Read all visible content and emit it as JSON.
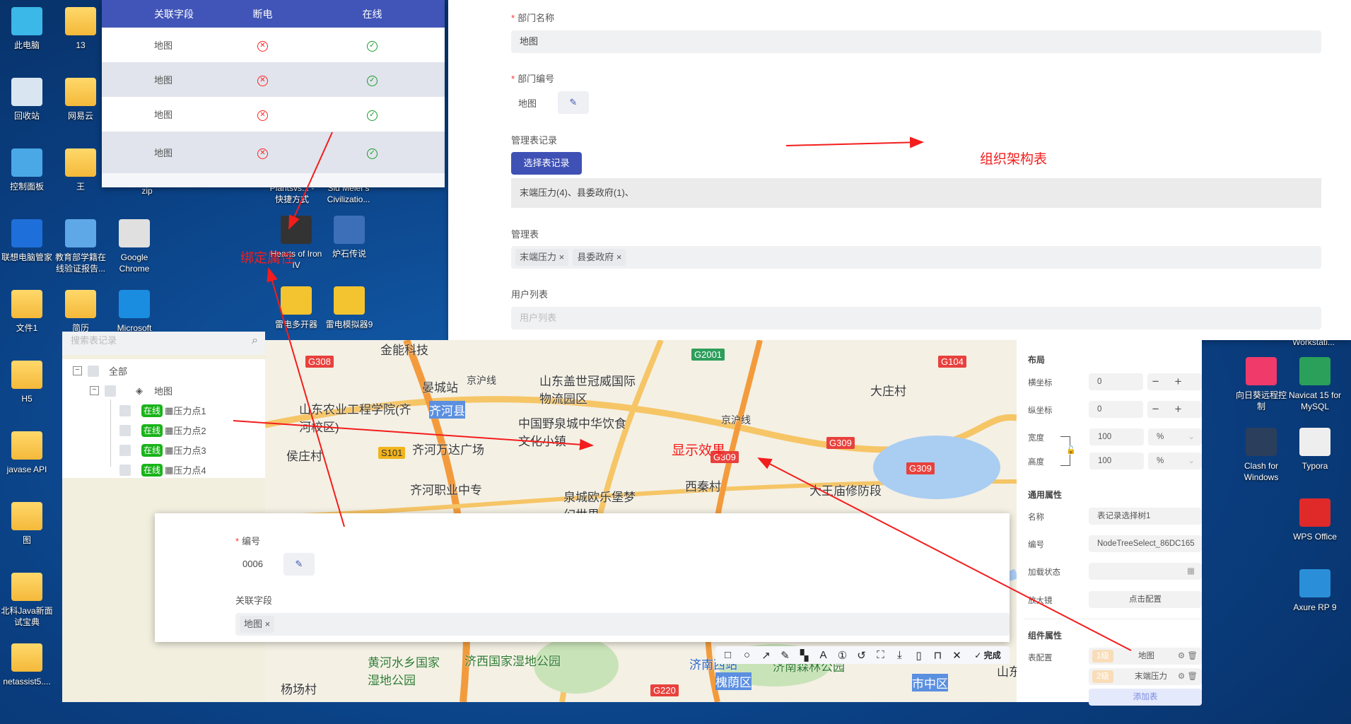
{
  "desktop": {
    "left_icons": [
      "此电脑",
      "13",
      "回收站",
      "网易云",
      "控制面板",
      "王",
      "联想电脑管家",
      "教育部学籍在线验证报告...",
      "Google Chrome",
      "文件1",
      "简历",
      "Microsoft",
      "H5",
      "javase API",
      "图",
      "北科Java新面试宝典",
      "netassist5...."
    ],
    "mid_icons": [
      "Hearts of Iron IV",
      "炉石传说",
      "雷电多开器",
      "雷电模拟器9"
    ],
    "partial_labels": [
      "zip",
      "Plantsvs... - 快捷方式",
      "Sid Meier's Civilizatio...",
      "Workstati..."
    ],
    "right_icons": [
      "向日葵远程控制",
      "Navicat 15 for MySQL",
      "Clash for Windows",
      "Typora",
      "WPS Office",
      "Axure RP 9"
    ]
  },
  "table": {
    "headers": [
      "关联字段",
      "断电",
      "在线"
    ],
    "rows": [
      [
        "地图",
        "offline",
        "online"
      ],
      [
        "地图",
        "offline",
        "online"
      ],
      [
        "地图",
        "offline",
        "online"
      ],
      [
        "地图",
        "offline",
        "online"
      ]
    ]
  },
  "form": {
    "dept_name_label": "部门名称",
    "dept_name_value": "地图",
    "dept_code_label": "部门编号",
    "dept_code_value": "地图",
    "records_label": "管理表记录",
    "select_button": "选择表记录",
    "records_value": "末端压力(4)、县委政府(1)、",
    "tables_label": "管理表",
    "tables": [
      "末端压力",
      "县委政府"
    ],
    "users_label": "用户列表",
    "users_placeholder": "用户列表"
  },
  "tree": {
    "search_placeholder": "搜索表记录",
    "root": "全部",
    "node": "地图",
    "status": "在线",
    "leaves": [
      "压力点1",
      "压力点2",
      "压力点3",
      "压力点4"
    ]
  },
  "map": {
    "labels": [
      "金能科技",
      "晏城站",
      "山东盖世冠威国际物流园区",
      "大庄村",
      "山东农业工程学院(齐河校区)",
      "齐河县",
      "京沪线",
      "中国野泉城中华饮食文化小镇",
      "京沪线",
      "侯庄村",
      "齐河万达广场",
      "齐河职业中专",
      "泉城欧乐堡梦幻世界",
      "西秦村",
      "大王庙修防段",
      "黄河水乡国家湿地公园",
      "济西国家湿地公园",
      "杨场村",
      "济南西站",
      "济南森林公园",
      "槐荫区",
      "市中区",
      "山东"
    ],
    "shields": [
      "G308",
      "G2001",
      "G104",
      "S101",
      "G309",
      "G309",
      "G309",
      "G220"
    ]
  },
  "props": {
    "layout_title": "布局",
    "x_label": "横坐标",
    "x_value": "0",
    "y_label": "纵坐标",
    "y_value": "0",
    "width_label": "宽度",
    "width_value": "100",
    "width_unit": "%",
    "height_label": "高度",
    "height_value": "100",
    "height_unit": "%",
    "general_title": "通用属性",
    "name_label": "名称",
    "name_value": "表记录选择树1",
    "code_label": "编号",
    "code_value": "NodeTreeSelect_86DC165",
    "load_label": "加载状态",
    "zoom_label": "放大镜",
    "zoom_button": "点击配置",
    "component_title": "组件属性",
    "table_config_label": "表配置",
    "levels": [
      {
        "level": "1级",
        "name": "地图"
      },
      {
        "level": "2级",
        "name": "末端压力"
      }
    ],
    "add_table": "添加表"
  },
  "dialog": {
    "code_label": "编号",
    "code_value": "0006",
    "field_label": "关联字段",
    "field_tag": "地图"
  },
  "screenshot_toolbar": {
    "icons": [
      "rectangle-icon",
      "ellipse-icon",
      "arrow-icon",
      "pencil-icon",
      "mosaic-icon",
      "text-icon",
      "number-icon",
      "undo-icon",
      "ocr-icon",
      "download-icon",
      "pin-icon",
      "bookmark-icon",
      "close-icon"
    ],
    "done": "完成"
  },
  "annotations": {
    "org_table": "组织架构表",
    "bind_attr": "绑定属性",
    "display_effect": "显示效果"
  },
  "colors": {
    "primary": "#3f51b5",
    "online": "#19b319",
    "offline": "#ff2222",
    "annotation": "#f31d1d"
  }
}
